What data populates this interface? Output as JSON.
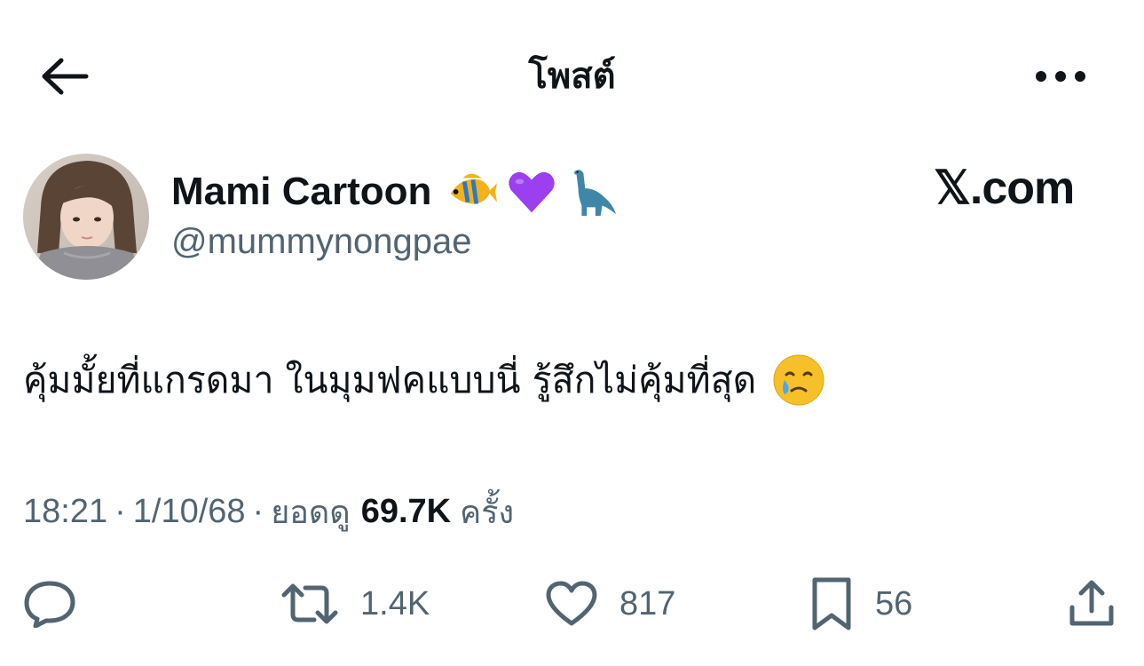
{
  "header": {
    "title": "โพสต์"
  },
  "post": {
    "author": {
      "display_name": "Mami Cartoon",
      "handle": "@mummynongpae",
      "name_emojis": [
        "tropical-fish",
        "purple-heart",
        "sauropod"
      ]
    },
    "watermark": "𝕏.com",
    "text": "คุ้มมั้ยที่แกรดมา ในมุมฟคแบบนี่ รู้สึกไม่คุ้มที่สุด",
    "trailing_emoji": "face-holding-back-tears",
    "meta": {
      "time": "18:21",
      "date": "1/10/68",
      "views_label": "ยอดดู",
      "views_count": "69.7K",
      "views_suffix": "ครั้ง",
      "separator": "·"
    },
    "actions": {
      "retweets": "1.4K",
      "likes": "817",
      "bookmarks": "56"
    }
  },
  "colors": {
    "text_primary": "#0f1419",
    "text_secondary": "#536471",
    "icon": "#536471",
    "background": "#ffffff"
  }
}
